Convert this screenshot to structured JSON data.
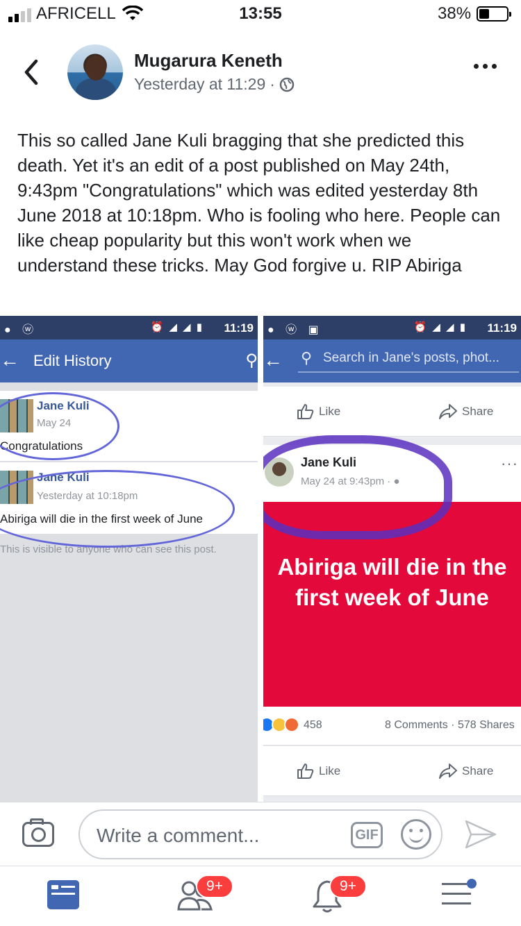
{
  "status_bar": {
    "carrier": "AFRICELL",
    "time": "13:55",
    "battery_percent": "38%",
    "battery_level": 0.38,
    "signal_bars_filled": 2,
    "signal_bars_total": 4
  },
  "post": {
    "author": "Mugarura Keneth",
    "timestamp": "Yesterday at 11:29",
    "separator": "·",
    "privacy_icon": "globe-icon",
    "text": "This so called Jane Kuli bragging that she predicted this death.  Yet it's an edit of a post published on May 24th, 9:43pm \"Congratulations\" which was edited yesterday 8th June 2018 at 10:18pm. Who is fooling who here.  People can like cheap popularity but this won't work when  we understand these tricks. May God forgive u. RIP Abiriga"
  },
  "embedded_screenshot": {
    "left_pane": {
      "status_time": "11:19",
      "title": "Edit History",
      "history": [
        {
          "name": "Jane Kuli",
          "date": "May 24",
          "text": "Congratulations"
        },
        {
          "name": "Jane Kuli",
          "date": "Yesterday at 10:18pm",
          "text": "Abiriga will die in the first week of June"
        }
      ],
      "visibility_note": "This is visible to anyone who can see this post."
    },
    "right_pane": {
      "status_time": "11:19",
      "search_placeholder": "Search in Jane's posts, phot...",
      "top_actions": {
        "like": "Like",
        "share": "Share"
      },
      "post": {
        "name": "Jane Kuli",
        "date": "May 24 at 9:43pm",
        "separator": "·",
        "message": "Abiriga will die in the first week of June",
        "background_color": "#e3093a"
      },
      "reactions": {
        "count": "458",
        "comments": "8 Comments",
        "dot": "·",
        "shares": "578 Shares"
      },
      "bottom_actions": {
        "like": "Like",
        "share": "Share"
      }
    }
  },
  "composer": {
    "placeholder": "Write a comment...",
    "gif_label": "GIF"
  },
  "tabs": [
    {
      "name": "news-feed",
      "icon": "newsfeed-icon",
      "active": true
    },
    {
      "name": "friends",
      "icon": "friends-icon",
      "badge": "9+"
    },
    {
      "name": "notifications",
      "icon": "bell-icon",
      "badge": "9+"
    },
    {
      "name": "menu",
      "icon": "menu-icon"
    }
  ],
  "colors": {
    "facebook_blue": "#4267b2",
    "annotation_purple": "#6366d9",
    "badge_red": "#fa3e3e"
  }
}
